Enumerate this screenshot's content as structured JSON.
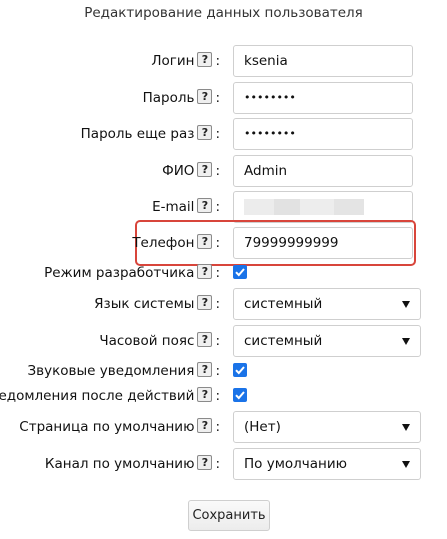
{
  "form": {
    "title": "Редактирование данных пользователя",
    "help_glyph": "?",
    "colon": ":",
    "fields": {
      "login": {
        "label": "Логин",
        "value": "ksenia"
      },
      "password": {
        "label": "Пароль",
        "value": "••••••••"
      },
      "password_repeat": {
        "label": "Пароль еще раз",
        "value": "••••••••"
      },
      "fio": {
        "label": "ФИО",
        "value": "Admin"
      },
      "email": {
        "label": "E-mail",
        "value": ""
      },
      "phone": {
        "label": "Телефон",
        "value": "79999999999"
      },
      "dev_mode": {
        "label": "Режим разработчика",
        "checked": true
      },
      "system_language": {
        "label": "Язык системы",
        "value": "системный"
      },
      "timezone": {
        "label": "Часовой пояс",
        "value": "системный"
      },
      "sound_notifications": {
        "label": "Звуковые уведомления",
        "checked": true
      },
      "action_notifications": {
        "label": "Уведомления после действий",
        "checked": true
      },
      "default_page": {
        "label": "Страница по умолчанию",
        "value": "(Нет)"
      },
      "default_channel": {
        "label": "Канал по умолчанию",
        "value": "По умолчанию"
      }
    },
    "save_label": "Сохранить"
  },
  "colors": {
    "checkbox": "#1a73e8",
    "highlight_border": "#d8453b"
  }
}
